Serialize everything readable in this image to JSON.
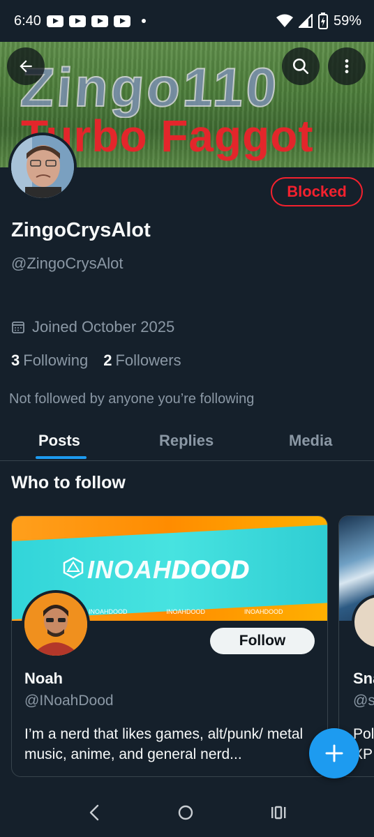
{
  "status_bar": {
    "time": "6:40",
    "notification_icons": [
      "youtube-icon",
      "youtube-icon",
      "youtube-icon",
      "youtube-icon"
    ],
    "battery_percent": "59%"
  },
  "banner": {
    "title_text": "Zingo110",
    "caption_text": "Turbo Faggot"
  },
  "header_buttons": [
    "back-arrow-icon",
    "search-icon",
    "more-vertical-icon"
  ],
  "profile": {
    "display_name": "ZingoCrysAlot",
    "handle": "@ZingoCrysAlot",
    "blocked_label": "Blocked",
    "joined": "Joined October 2025",
    "following_count": "3",
    "following_label": "Following",
    "followers_count": "2",
    "followers_label": "Followers",
    "not_followed_text": "Not followed by anyone you’re following"
  },
  "tabs": [
    {
      "label": "Posts",
      "active": true
    },
    {
      "label": "Replies",
      "active": false
    },
    {
      "label": "Media",
      "active": false
    }
  ],
  "who_to_follow": {
    "title": "Who to follow",
    "cards": [
      {
        "banner_brand_light": "INOAH",
        "banner_brand_heavy": "DOOD",
        "banner_socials": [
          "INOAHDOOD",
          "INOAHDOOD",
          "INOAHDOOD"
        ],
        "name": "Noah",
        "handle": "@INoahDood",
        "bio": "I’m a nerd that likes games, alt/punk/ metal music, anime, and general nerd...",
        "follow_label": "Follow"
      },
      {
        "name": "Sna",
        "handle": "@s",
        "bio_line1": "Pol",
        "bio_line2": "XP"
      }
    ]
  },
  "fab_icon": "plus-icon",
  "nav_bar": [
    "back-icon",
    "home-icon",
    "recents-icon"
  ],
  "colors": {
    "background": "#15202b",
    "accent": "#1d9bf0",
    "blocked": "#f4212e",
    "secondary_text": "#8b98a5"
  }
}
